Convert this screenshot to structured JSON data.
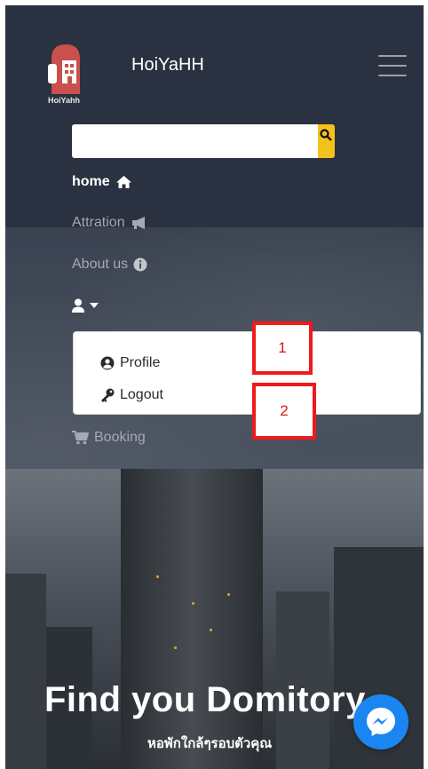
{
  "brand": {
    "name": "HoiYaHH",
    "logo_text": "HoiYahh"
  },
  "search": {
    "value": "",
    "placeholder": ""
  },
  "nav": {
    "home": "home",
    "attraction": "Attration",
    "about": "About us",
    "booking": "Booking"
  },
  "dropdown": {
    "profile": "Profile",
    "logout": "Logout"
  },
  "callouts": [
    "1",
    "2"
  ],
  "hero": {
    "title": "Find you Domitory",
    "subtitle": "หอพักใกล้ๆรอบตัวคุณ"
  },
  "colors": {
    "navbar": "#2a3140",
    "search_button": "#f4c21a",
    "callout": "#ef1a1a",
    "messenger": "#1b86f2"
  },
  "icons": {
    "home": "house-icon",
    "attraction": "bullhorn-icon",
    "about": "info-circle-icon",
    "user": "user-icon",
    "booking": "shopping-cart-icon",
    "profile": "user-circle-icon",
    "logout": "key-icon",
    "search": "search-icon",
    "menu": "hamburger-icon",
    "chat": "messenger-icon"
  }
}
